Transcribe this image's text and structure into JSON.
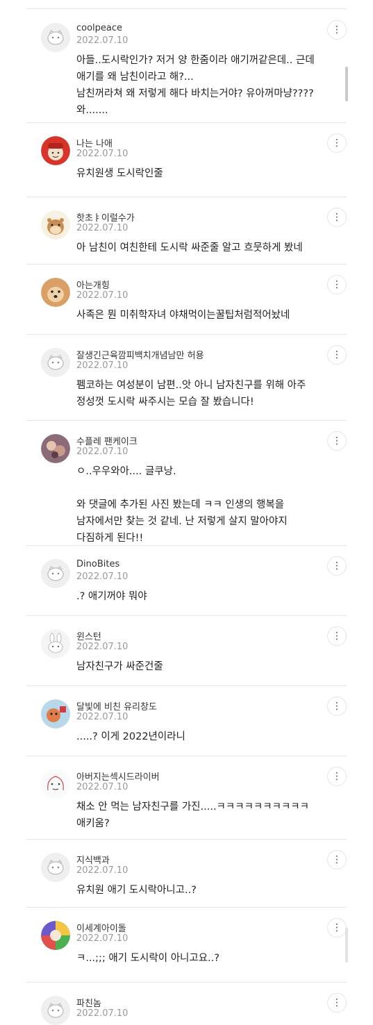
{
  "comments": [
    {
      "name": "coolpeace",
      "date": "2022.07.10",
      "text": "아들..도시락인가? 저거 양 한줌이라 애기꺼같은데.. 근데\n애기를 왜 남친이라고 해?...\n남친꺼라쳐 왜 저렇게 해다 바치는거야? 유아꺼마냥????\n와.......",
      "avatar": "default-avatar-icon"
    },
    {
      "name": "나는 나애",
      "date": "2022.07.10",
      "text": "유치원생 도시락인줄",
      "avatar": "red-hood-avatar-icon"
    },
    {
      "name": "핫초ㅑ이럴수가",
      "date": "2022.07.10",
      "text": "아 남친이 여친한테 도시락 싸준줄 알고 흐뭇하게 봤네",
      "avatar": "hamster-avatar-icon"
    },
    {
      "name": "아는개힝",
      "date": "2022.07.10",
      "text": "사족은 뭔 미취학자녀 야채먹이는꿀팁처럼적어놨네",
      "avatar": "dog-avatar-icon"
    },
    {
      "name": "잘생긴근육깜피백치개념남만 허용",
      "date": "2022.07.10",
      "text": "펨코하는 여성분이 남편..앗 아니 남자친구를 위해 아주\n정성껏 도시락 싸주시는 모습 잘 봤습니다!",
      "avatar": "default-avatar-icon"
    },
    {
      "name": "수플레 팬케이크",
      "date": "2022.07.10",
      "text": "ㅇ..우우와아.... 글쿠낭.\n\n와 댓글에 추가된 사진 봤는데 ㅋㅋ 인생의 행복을\n남자에서만 찾는 것 같네. 난 저렇게 살지 말아야지\n다짐하게 된다!!",
      "avatar": "photo-avatar-icon"
    },
    {
      "name": "DinoBites",
      "date": "2022.07.10",
      "text": ".? 애기꺼야 뭐야",
      "avatar": "default-avatar-icon"
    },
    {
      "name": "윈스턴",
      "date": "2022.07.10",
      "text": "남자친구가 싸준건줄",
      "avatar": "bunny-avatar-icon"
    },
    {
      "name": "달빛에 비친 유리창도",
      "date": "2022.07.10",
      "text": ".....? 이게 2022년이라니",
      "avatar": "cartoon-avatar-icon"
    },
    {
      "name": "아버지는섹시드라이버",
      "date": "2022.07.10",
      "text": "채소 안 먹는 남자친구를 가진.....ㅋㅋㅋㅋㅋㅋㅋㅋㅋㅋ\n애키움?",
      "avatar": "sketch-face-avatar-icon"
    },
    {
      "name": "지식백과",
      "date": "2022.07.10",
      "text": "유치원 애기 도시락아니고..?",
      "avatar": "default-avatar-icon"
    },
    {
      "name": "이세계아이돌",
      "date": "2022.07.10",
      "text": "ㅋ...;;; 애기 도시락이 아니고요..?",
      "avatar": "colorful-avatar-icon"
    },
    {
      "name": "파친놈",
      "date": "2022.07.10",
      "text": "",
      "avatar": "default-avatar-icon"
    }
  ],
  "more_label": "⋮",
  "colors": {
    "divider": "#e6e6e6",
    "date": "#999999",
    "text": "#222222"
  }
}
